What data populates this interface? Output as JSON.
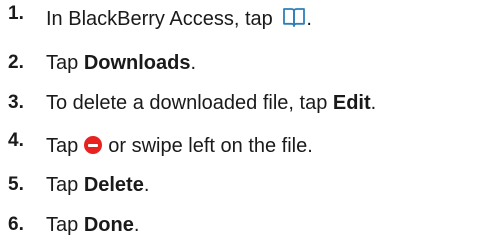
{
  "steps": [
    {
      "number": "1.",
      "text_before": "In BlackBerry Access, tap ",
      "icon": "book-icon",
      "text_after": "."
    },
    {
      "number": "2.",
      "text_before": "Tap ",
      "bold": "Downloads",
      "text_after": "."
    },
    {
      "number": "3.",
      "text_before": "To delete a downloaded file, tap ",
      "bold": "Edit",
      "text_after": "."
    },
    {
      "number": "4.",
      "text_before": "Tap",
      "icon": "minus-circle-icon",
      "text_after": "or swipe left on the file."
    },
    {
      "number": "5.",
      "text_before": "Tap ",
      "bold": "Delete",
      "text_after": "."
    },
    {
      "number": "6.",
      "text_before": "Tap ",
      "bold": "Done",
      "text_after": "."
    }
  ],
  "colors": {
    "text": "#1a1a1a",
    "minus_icon": "#e8231f",
    "book_icon": "#2e7fb8"
  }
}
